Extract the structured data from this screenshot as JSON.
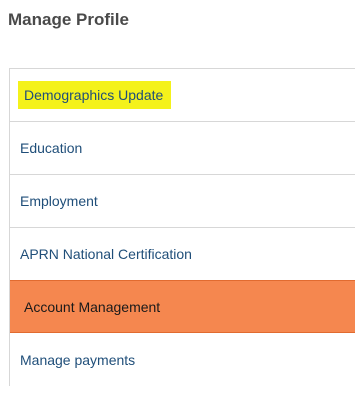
{
  "page": {
    "title": "Manage Profile"
  },
  "menu": {
    "items": [
      {
        "label": "Demographics Update"
      },
      {
        "label": "Education"
      },
      {
        "label": "Employment"
      },
      {
        "label": "APRN National Certification"
      },
      {
        "label": "Account Management"
      },
      {
        "label": "Manage payments"
      }
    ]
  },
  "colors": {
    "highlight": "#f4f21b",
    "active_background": "#f5874f",
    "link_text": "#1f4e79"
  }
}
